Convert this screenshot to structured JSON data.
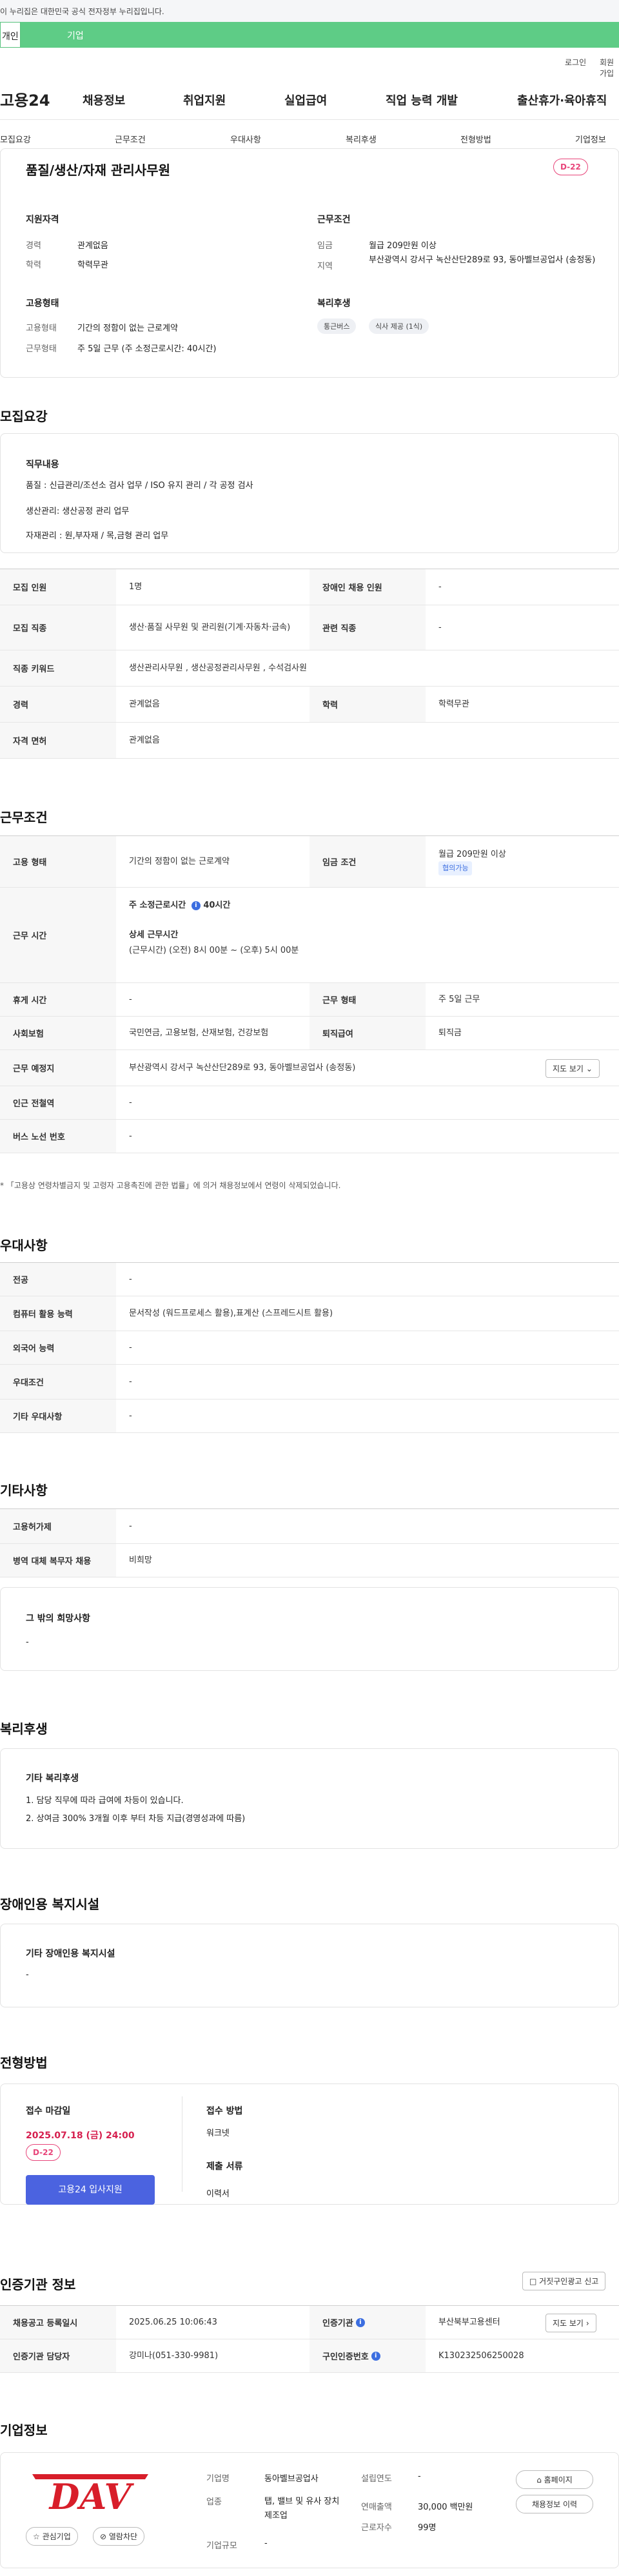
{
  "gov_banner": "이 누리집은 대한민국 공식 전자정부 누리집입니다.",
  "top_tabs": [
    "개인",
    "기업"
  ],
  "util_links": [
    "로그인",
    "회원가입"
  ],
  "gnb": {
    "logo": "고용24",
    "items": [
      "채용정보",
      "취업지원",
      "실업급여",
      "직업 능력 개발",
      "출산휴가·육아휴직"
    ]
  },
  "subnav": [
    "모집요강",
    "근무조건",
    "우대사항",
    "복리후생",
    "전형방법",
    "기업정보"
  ],
  "summary": {
    "title": "품질/생산/자재 관리사무원",
    "dday": "D-22",
    "qual_head": "지원자격",
    "career_label": "경력",
    "career_value": "관계없음",
    "edu_label": "학력",
    "edu_value": "학력무관",
    "work_head": "근무조건",
    "wage_label": "임금",
    "wage_value": "월급 209만원 이상",
    "region_label": "지역",
    "region_value": "부산광역시 강서구 녹산산단289로 93, 동아벨브공업사 (송정동)",
    "emp_head": "고용형태",
    "emp_type_label": "고용형태",
    "emp_type_value": "기간의 정함이 없는 근로계약",
    "work_form_label": "근무형태",
    "work_form_value": "주 5일 근무 (주 소정근로시간: 40시간)",
    "welfare_head": "복리후생",
    "welfare_chips": [
      "통근버스",
      "식사 제공 (1식)"
    ]
  },
  "recruit": {
    "title": "모집요강",
    "duty_head": "직무내용",
    "duty_lines": [
      "품질 : 신급관리/조선소 검사 업무 / ISO  유지 관리 / 각 공정 검사",
      "생산관리: 생산공정 관리 업무",
      "자재관리 : 원,부자재  / 목,금형 관리 업무"
    ],
    "rows": [
      {
        "l1": "모집 인원",
        "v1": "1명",
        "l2": "장애인 채용 인원",
        "v2": "-"
      },
      {
        "l1": "모집 직종",
        "v1": "생산·품질 사무원 및 관리원(기계·자동차·금속)",
        "l2": "관련 직종",
        "v2": "-"
      },
      {
        "l1": "직종 키워드",
        "v1": "생산관리사무원 , 생산공정관리사무원 , 수석검사원"
      },
      {
        "l1": "경력",
        "v1": "관계없음",
        "l2": "학력",
        "v2": "학력무관"
      },
      {
        "l1": "자격 면허",
        "v1": "관계없음"
      }
    ]
  },
  "conditions": {
    "title": "근무조건",
    "emp_type_label": "고용 형태",
    "emp_type_value": "기간의 정함이 없는 근로계약",
    "wage_label": "임금 조건",
    "wage_value": "월급 209만원 이상",
    "wage_tag": "협의가능",
    "hours_label": "근무 시간",
    "hours_week_label": "주 소정근로시간",
    "hours_week_value": "40시간",
    "hours_detail_label": "상세 근무시간",
    "hours_detail_value": "(근무시간) (오전) 8시 00분 ~ (오후) 5시 00분",
    "rest_label": "휴게 시간",
    "rest_value": "-",
    "form_label": "근무 형태",
    "form_value": "주 5일 근무",
    "insurance_label": "사회보험",
    "insurance_value": "국민연금, 고용보험, 산재보험, 건강보험",
    "retire_label": "퇴직급여",
    "retire_value": "퇴직금",
    "place_label": "근무 예정지",
    "place_value": "부산광역시 강서구 녹산산단289로 93, 동아벨브공업사 (송정동)",
    "map_button": "지도 보기",
    "subway_label": "인근 전철역",
    "subway_value": "-",
    "bus_label": "버스 노선 번호",
    "bus_value": "-",
    "note": "* 「고용상 연령차별금지 및 고령자 고용촉진에 관한 법률」에 의거 채용정보에서 연령이 삭제되었습니다."
  },
  "preference": {
    "title": "우대사항",
    "rows": [
      {
        "l": "전공",
        "v": "-"
      },
      {
        "l": "컴퓨터 활용 능력",
        "v": "문서작성 (워드프로세스 활용),표계산 (스프레드시트 활용)"
      },
      {
        "l": "외국어 능력",
        "v": "-"
      },
      {
        "l": "우대조건",
        "v": "-"
      },
      {
        "l": "기타 우대사항",
        "v": "-"
      }
    ]
  },
  "etc": {
    "title": "기타사항",
    "rows": [
      {
        "l": "고용허가제",
        "v": "-"
      },
      {
        "l": "병역 대체 복무자 채용",
        "v": "비희망"
      }
    ],
    "other_head": "그 밖의 희망사항",
    "other_value": "-"
  },
  "welfare": {
    "title": "복리후생",
    "head": "기타 복리후생",
    "lines": [
      "1. 담당 직무에 따라 급여에 차등이 있습니다.",
      "2. 상여금 300%  3개월 이후 부터 차등 지급(경영성과에 따름)"
    ]
  },
  "disability": {
    "title": "장애인용 복지시설",
    "head": "기타 장애인용 복지시설",
    "value": "-"
  },
  "screening": {
    "title": "전형방법",
    "deadline_label": "접수 마감일",
    "deadline_value": "2025.07.18 (금) 24:00",
    "dday": "D-22",
    "apply_button": "고용24 입사지원",
    "method_label": "접수 방법",
    "method_value": "워크넷",
    "docs_label": "제출 서류",
    "docs_value": "이력서"
  },
  "agency": {
    "title": "인증기관 정보",
    "report_button": "거짓구인광고 신고",
    "reg_date_label": "채용공고 등록일시",
    "reg_date_value": "2025.06.25 10:06:43",
    "agency_label": "인증기관",
    "agency_value": "부산북부고용센터",
    "map_button": "지도 보기",
    "manager_label": "인증기관 담당자",
    "manager_value": "강미나(051-330-9981)",
    "offer_no_label": "구인인증번호",
    "offer_no_value": "K130232506250028"
  },
  "company": {
    "title": "기업정보",
    "logo_text": "DAV",
    "fav_button": "관심기업",
    "block_button": "열람차단",
    "name_label": "기업명",
    "name_value": "동아벨브공업사",
    "industry_label": "업종",
    "industry_value": "탭, 밸브 및 유사 장치 제조업",
    "size_label": "기업규모",
    "size_value": "-",
    "founded_label": "설립연도",
    "founded_value": "-",
    "sales_label": "연매출액",
    "sales_value": "30,000 백만원",
    "employees_label": "근로자수",
    "employees_value": "99명",
    "home_button": "홈페이지",
    "jobs_button": "채용정보 이력"
  }
}
